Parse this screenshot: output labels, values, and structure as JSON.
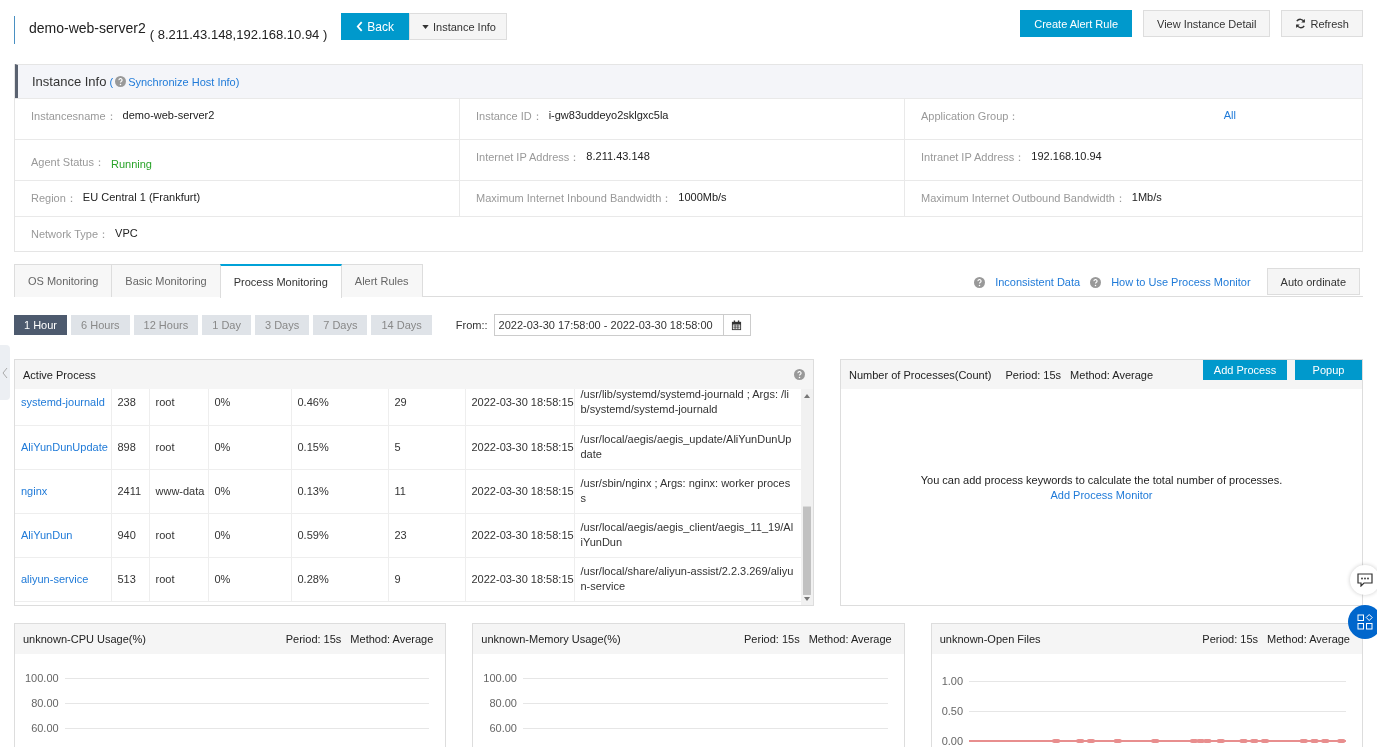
{
  "header": {
    "name": "demo-web-server2",
    "ips": "( 8.211.43.148,192.168.10.94 )",
    "back_button": "Back",
    "dropdown_button": "Instance Info",
    "actions": [
      {
        "label": "Create Alert Rule",
        "kind": "primary"
      },
      {
        "label": "View Instance Detail",
        "kind": "default"
      },
      {
        "label": "Refresh",
        "kind": "refresh"
      }
    ]
  },
  "instance_info": {
    "title": "Instance Info",
    "sync_link": {
      "prefix": "(",
      "label": "Synchronize Host Info",
      "suffix": ")"
    },
    "rows": [
      [
        {
          "label": "Instancesname：",
          "value": "demo-web-server2",
          "kind": "text"
        },
        {
          "label": "Instance ID：",
          "value": "i-gw83uddeyo2sklgxc5la",
          "kind": "text"
        },
        {
          "label": "Application Group：",
          "value": "All",
          "kind": "link"
        }
      ],
      [
        {
          "label": "Agent Status：",
          "value": "Running",
          "kind": "status"
        },
        {
          "label": "Internet IP Address：",
          "value": "8.211.43.148",
          "kind": "text"
        },
        {
          "label": "Intranet IP Address：",
          "value": "192.168.10.94",
          "kind": "text"
        }
      ],
      [
        {
          "label": "Region：",
          "value": "EU Central 1 (Frankfurt)",
          "kind": "text"
        },
        {
          "label": "Maximum Internet Inbound Bandwidth：",
          "value": "1000Mb/s",
          "kind": "text"
        },
        {
          "label": "Maximum Internet Outbound Bandwidth：",
          "value": "1Mb/s",
          "kind": "text"
        }
      ],
      [
        {
          "label": "Network Type：",
          "value": "VPC",
          "kind": "text"
        }
      ]
    ]
  },
  "tabs": [
    {
      "label": "OS Monitoring",
      "selected": false
    },
    {
      "label": "Basic Monitoring",
      "selected": false
    },
    {
      "label": "Process Monitoring",
      "selected": true
    },
    {
      "label": "Alert Rules",
      "selected": false
    }
  ],
  "help_links": [
    {
      "label": "Inconsistent Data"
    },
    {
      "label": "How to Use Process Monitor"
    }
  ],
  "auto_ordinate_button": "Auto ordinate",
  "time_ranges": [
    {
      "label": "1 Hour",
      "selected": true
    },
    {
      "label": "6 Hours",
      "selected": false
    },
    {
      "label": "12 Hours",
      "selected": false
    },
    {
      "label": "1 Day",
      "selected": false
    },
    {
      "label": "3 Days",
      "selected": false
    },
    {
      "label": "7 Days",
      "selected": false
    },
    {
      "label": "14 Days",
      "selected": false
    }
  ],
  "date_filter": {
    "label": "From::",
    "value": "2022-03-30 17:58:00 - 2022-03-30 18:58:00"
  },
  "active_process": {
    "title": "Active Process",
    "rows": [
      {
        "cells": [
          "systemd-journald",
          "238",
          "root",
          "0%",
          "0.46%",
          "29",
          "2022-03-30 18:58:15",
          "/usr/lib/systemd/systemd-journald ; Args: /lib/systemd/systemd-journald"
        ]
      },
      {
        "cells": [
          "AliYunDunUpdate",
          "898",
          "root",
          "0%",
          "0.15%",
          "5",
          "2022-03-30 18:58:15",
          "/usr/local/aegis/aegis_update/AliYunDunUpdate"
        ]
      },
      {
        "cells": [
          "nginx",
          "2411",
          "www-data",
          "0%",
          "0.13%",
          "11",
          "2022-03-30 18:58:15",
          "/usr/sbin/nginx ; Args: nginx: worker process"
        ]
      },
      {
        "cells": [
          "AliYunDun",
          "940",
          "root",
          "0%",
          "0.59%",
          "23",
          "2022-03-30 18:58:15",
          "/usr/local/aegis/aegis_client/aegis_11_19/AliYunDun"
        ]
      },
      {
        "cells": [
          "aliyun-service",
          "513",
          "root",
          "0%",
          "0.28%",
          "9",
          "2022-03-30 18:58:15",
          "/usr/local/share/aliyun-assist/2.2.3.269/aliyun-service"
        ]
      }
    ]
  },
  "process_count": {
    "title": "Number of Processes(Count)",
    "period": "Period: 15s",
    "method": "Method: Average",
    "buttons": [
      "Add Process",
      "Popup"
    ],
    "message": "You can add process keywords to calculate the total number of processes.",
    "link": "Add Process Monitor"
  },
  "charts": [
    {
      "title": "unknown-CPU Usage(%)",
      "period": "Period: 15s",
      "method": "Method: Average",
      "kind": "empty",
      "y_labels": [
        "100.00",
        "80.00",
        "60.00"
      ]
    },
    {
      "title": "unknown-Memory Usage(%)",
      "period": "Period: 15s",
      "method": "Method: Average",
      "kind": "empty",
      "y_labels": [
        "100.00",
        "80.00",
        "60.00"
      ]
    },
    {
      "title": "unknown-Open Files",
      "period": "Period: 15s",
      "method": "Method: Average",
      "kind": "line",
      "y_labels": [
        "1.00",
        "0.50",
        "0.00"
      ]
    }
  ]
}
